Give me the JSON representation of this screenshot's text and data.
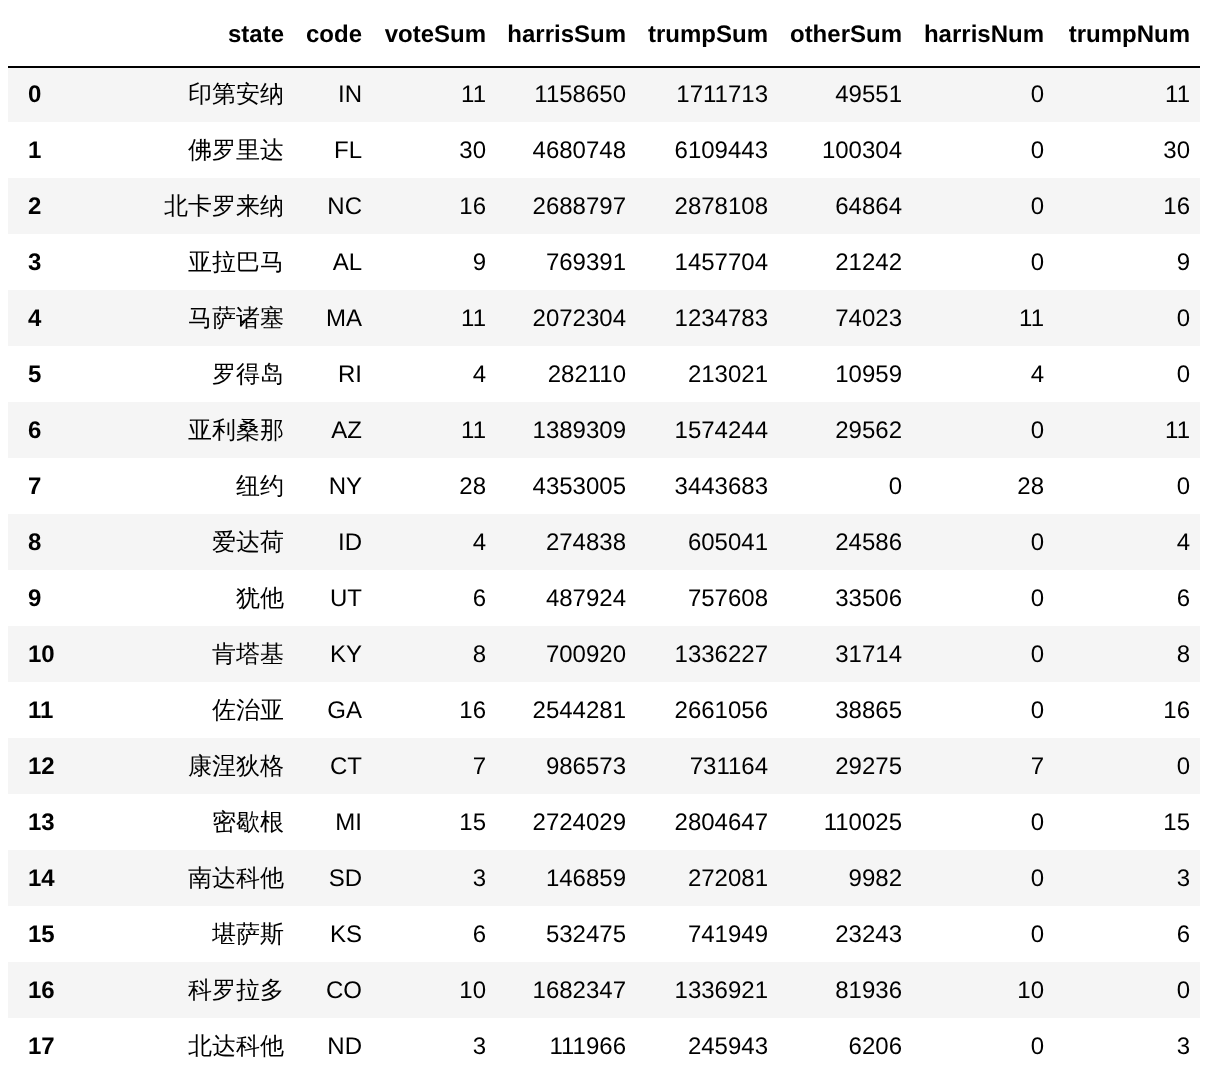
{
  "table": {
    "columns": [
      "state",
      "code",
      "voteSum",
      "harrisSum",
      "trumpSum",
      "otherSum",
      "harrisNum",
      "trumpNum"
    ],
    "rows": [
      {
        "index": "0",
        "cells": [
          "印第安纳",
          "IN",
          "11",
          "1158650",
          "1711713",
          "49551",
          "0",
          "11"
        ]
      },
      {
        "index": "1",
        "cells": [
          "佛罗里达",
          "FL",
          "30",
          "4680748",
          "6109443",
          "100304",
          "0",
          "30"
        ]
      },
      {
        "index": "2",
        "cells": [
          "北卡罗来纳",
          "NC",
          "16",
          "2688797",
          "2878108",
          "64864",
          "0",
          "16"
        ]
      },
      {
        "index": "3",
        "cells": [
          "亚拉巴马",
          "AL",
          "9",
          "769391",
          "1457704",
          "21242",
          "0",
          "9"
        ]
      },
      {
        "index": "4",
        "cells": [
          "马萨诸塞",
          "MA",
          "11",
          "2072304",
          "1234783",
          "74023",
          "11",
          "0"
        ]
      },
      {
        "index": "5",
        "cells": [
          "罗得岛",
          "RI",
          "4",
          "282110",
          "213021",
          "10959",
          "4",
          "0"
        ]
      },
      {
        "index": "6",
        "cells": [
          "亚利桑那",
          "AZ",
          "11",
          "1389309",
          "1574244",
          "29562",
          "0",
          "11"
        ]
      },
      {
        "index": "7",
        "cells": [
          "纽约",
          "NY",
          "28",
          "4353005",
          "3443683",
          "0",
          "28",
          "0"
        ]
      },
      {
        "index": "8",
        "cells": [
          "爱达荷",
          "ID",
          "4",
          "274838",
          "605041",
          "24586",
          "0",
          "4"
        ]
      },
      {
        "index": "9",
        "cells": [
          "犹他",
          "UT",
          "6",
          "487924",
          "757608",
          "33506",
          "0",
          "6"
        ]
      },
      {
        "index": "10",
        "cells": [
          "肯塔基",
          "KY",
          "8",
          "700920",
          "1336227",
          "31714",
          "0",
          "8"
        ]
      },
      {
        "index": "11",
        "cells": [
          "佐治亚",
          "GA",
          "16",
          "2544281",
          "2661056",
          "38865",
          "0",
          "16"
        ]
      },
      {
        "index": "12",
        "cells": [
          "康涅狄格",
          "CT",
          "7",
          "986573",
          "731164",
          "29275",
          "7",
          "0"
        ]
      },
      {
        "index": "13",
        "cells": [
          "密歇根",
          "MI",
          "15",
          "2724029",
          "2804647",
          "110025",
          "0",
          "15"
        ]
      },
      {
        "index": "14",
        "cells": [
          "南达科他",
          "SD",
          "3",
          "146859",
          "272081",
          "9982",
          "0",
          "3"
        ]
      },
      {
        "index": "15",
        "cells": [
          "堪萨斯",
          "KS",
          "6",
          "532475",
          "741949",
          "23243",
          "0",
          "6"
        ]
      },
      {
        "index": "16",
        "cells": [
          "科罗拉多",
          "CO",
          "10",
          "1682347",
          "1336921",
          "81936",
          "10",
          "0"
        ]
      },
      {
        "index": "17",
        "cells": [
          "北达科他",
          "ND",
          "3",
          "111966",
          "245943",
          "6206",
          "0",
          "3"
        ]
      }
    ]
  }
}
